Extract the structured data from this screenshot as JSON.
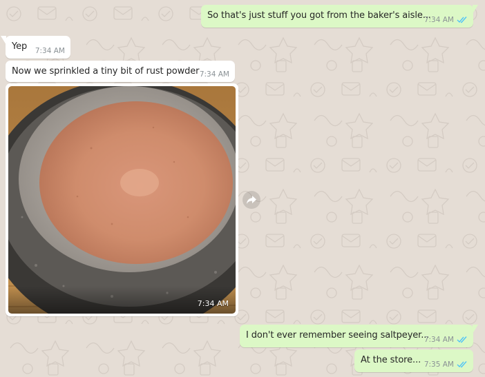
{
  "colors": {
    "background": "#e5ddd5",
    "incoming_bubble": "#ffffff",
    "outgoing_bubble": "#dcf8c6",
    "read_ticks": "#4fc3f7",
    "timestamp": "#8a9195"
  },
  "messages": [
    {
      "direction": "outgoing",
      "text": "So that's just stuff you got from the baker's aisle...",
      "time": "7:34 AM",
      "status": "read"
    },
    {
      "direction": "incoming",
      "text": "Yep",
      "time": "7:34 AM"
    },
    {
      "direction": "incoming",
      "text": "Now we sprinkled a tiny bit of rust powder",
      "time": "7:34 AM"
    },
    {
      "direction": "incoming",
      "type": "image",
      "image_subject": "reddish-brown powder in a stone mortar",
      "time": "7:34 AM"
    },
    {
      "direction": "outgoing",
      "text": "I don't ever remember seeing saltpeyer...",
      "time": "7:34 AM",
      "status": "read"
    },
    {
      "direction": "outgoing",
      "text": "At the store...",
      "time": "7:35 AM",
      "status": "read"
    }
  ],
  "icons": {
    "forward": "forward-arrow-icon",
    "read_receipt": "double-check-icon"
  }
}
